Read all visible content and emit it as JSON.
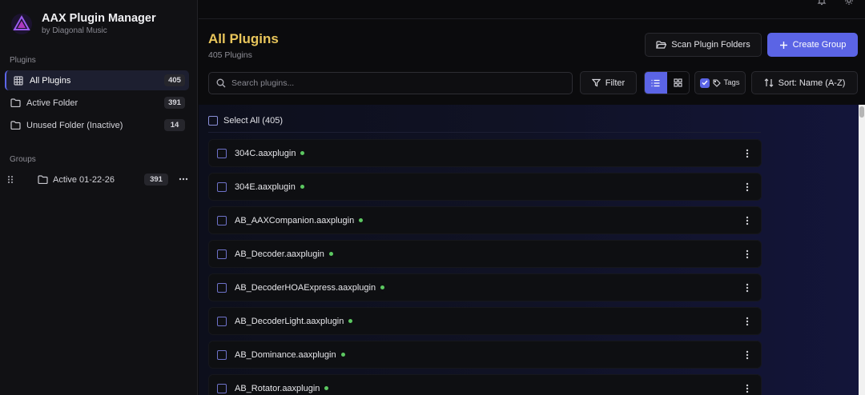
{
  "app": {
    "title": "AAX Plugin Manager",
    "subtitle": "by Diagonal Music"
  },
  "sidebar": {
    "plugins_label": "Plugins",
    "items": [
      {
        "label": "All Plugins",
        "count": "405",
        "icon": "grid-icon"
      },
      {
        "label": "Active Folder",
        "count": "391",
        "icon": "folder-icon"
      },
      {
        "label": "Unused Folder (Inactive)",
        "count": "14",
        "icon": "folder-icon"
      }
    ],
    "groups_label": "Groups",
    "groups": [
      {
        "label": "Active 01-22-26",
        "count": "391"
      }
    ]
  },
  "header": {
    "title": "All Plugins",
    "subtitle": "405 Plugins",
    "scan_label": "Scan Plugin Folders",
    "create_label": "Create Group"
  },
  "toolbar": {
    "search_placeholder": "Search plugins...",
    "filter_label": "Filter",
    "tags_label": "Tags",
    "sort_label": "Sort: Name (A-Z)"
  },
  "list": {
    "select_all_label": "Select All (405)",
    "rows": [
      {
        "name": "304C.aaxplugin"
      },
      {
        "name": "304E.aaxplugin"
      },
      {
        "name": "AB_AAXCompanion.aaxplugin"
      },
      {
        "name": "AB_Decoder.aaxplugin"
      },
      {
        "name": "AB_DecoderHOAExpress.aaxplugin"
      },
      {
        "name": "AB_DecoderLight.aaxplugin"
      },
      {
        "name": "AB_Dominance.aaxplugin"
      },
      {
        "name": "AB_Rotator.aaxplugin"
      }
    ]
  },
  "colors": {
    "accent": "#5b64e5",
    "title_gold": "#e8c55b",
    "status_active": "#5cc861"
  }
}
